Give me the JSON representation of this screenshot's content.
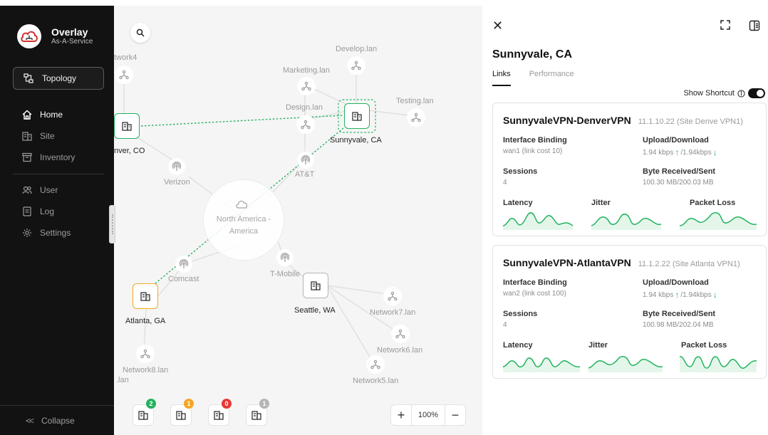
{
  "brand": {
    "title": "Overlay",
    "subtitle": "As-A-Service"
  },
  "sidebar": {
    "topology_label": "Topology",
    "items": [
      {
        "label": "Home",
        "icon": "home-icon",
        "active": true
      },
      {
        "label": "Site",
        "icon": "building-icon"
      },
      {
        "label": "Inventory",
        "icon": "inventory-icon"
      },
      {
        "label": "User",
        "icon": "users-icon"
      },
      {
        "label": "Log",
        "icon": "log-icon"
      },
      {
        "label": "Settings",
        "icon": "gear-icon"
      }
    ],
    "collapse_label": "Collapse"
  },
  "map": {
    "lans": [
      "twork4",
      "Develop.lan",
      "Marketing.lan",
      "Design.lan",
      "Testing.lan",
      "Network7.lan",
      "Network6.lan",
      "Network5.lan",
      "Network8.lan",
      ".lan"
    ],
    "sites": {
      "denver": "nver, CO",
      "sunnyvale": "Sunnyvale, CA",
      "atlanta": "Atlanta, GA",
      "seattle": "Seattle, WA"
    },
    "isps": [
      "AT&T",
      "Verizon",
      "Comcast",
      "T-Mobile"
    ],
    "region": "North America - America",
    "status_counts": [
      {
        "count": "2",
        "color": "#22b35e"
      },
      {
        "count": "1",
        "color": "#f5a623"
      },
      {
        "count": "0",
        "color": "#e53935"
      },
      {
        "count": "1",
        "color": "#b5b5b5"
      }
    ],
    "zoom": "100%",
    "colors": {
      "ok": "#22b35e",
      "warn": "#f5a623"
    }
  },
  "panel": {
    "title": "Sunnyvale, CA",
    "tabs": [
      "Links",
      "Performance"
    ],
    "shortcut_label": "Show Shortcut",
    "links": [
      {
        "name": "SunnyvaleVPN-DenverVPN",
        "ip": "11.1.10.22 (Site Denve VPN1)",
        "binding_label": "Interface Binding",
        "binding": "wan1 (link cost 10)",
        "updown_label": "Upload/Download",
        "upload": "1.94 kbps",
        "download": "/1.94kbps",
        "sessions_label": "Sessions",
        "sessions": "4",
        "bytes_label": "Byte Received/Sent",
        "bytes": "100.30 MB/200.03 MB",
        "latency_label": "Latency",
        "jitter_label": "Jitter",
        "loss_label": "Packet Loss"
      },
      {
        "name": "SunnyvaleVPN-AtlantaVPN",
        "ip": "11.1.2.22 (Site Atlanta VPN1)",
        "binding_label": "Interface Binding",
        "binding": "wan2 (link cost 100)",
        "updown_label": "Upload/Download",
        "upload": "1.94 kbps",
        "download": "/1.94kbps",
        "sessions_label": "Sessions",
        "sessions": "4",
        "bytes_label": "Byte Received/Sent",
        "bytes": "100.98 MB/202.04 MB",
        "latency_label": "Latency",
        "jitter_label": "Jitter",
        "loss_label": "Packet Loss"
      }
    ]
  }
}
